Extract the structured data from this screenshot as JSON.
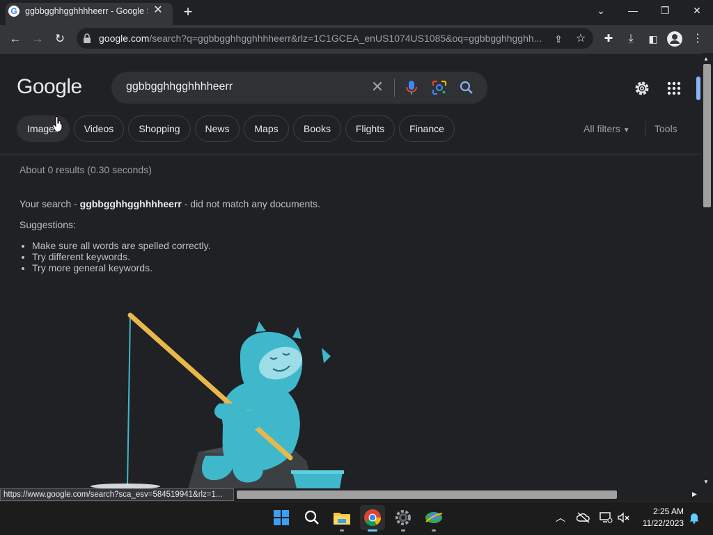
{
  "browser": {
    "tab_title": "ggbbgghhgghhhheerr - Google Search",
    "tab_favicon": "G",
    "new_tab_label": "+",
    "url_host": "google.com",
    "url_rest": "/search?q=ggbbgghhgghhhheerr&rlz=1C1GCEA_enUS1074US1085&oq=ggbbgghhgghh..."
  },
  "google": {
    "logo": "Google",
    "query": "ggbbgghhgghhhheerr",
    "chips": [
      "Images",
      "Videos",
      "Shopping",
      "News",
      "Maps",
      "Books",
      "Flights",
      "Finance"
    ],
    "all_filters": "All filters",
    "tools": "Tools"
  },
  "results": {
    "stats": "About 0 results (0.30 seconds)",
    "nomatch_prefix": "Your search - ",
    "nomatch_query": "ggbbgghhgghhhheerr",
    "nomatch_suffix": " - did not match any documents.",
    "suggestions_label": "Suggestions:",
    "suggestions": [
      "Make sure all words are spelled correctly.",
      "Try different keywords.",
      "Try more general keywords."
    ]
  },
  "status_bar_url": "https://www.google.com/search?sca_esv=584519941&rlz=1...",
  "taskbar": {
    "time": "2:25 AM",
    "date": "11/22/2023"
  },
  "colors": {
    "background": "#202124",
    "accent_blue": "#8ab4f8",
    "yeti": "#3fb8cc"
  }
}
